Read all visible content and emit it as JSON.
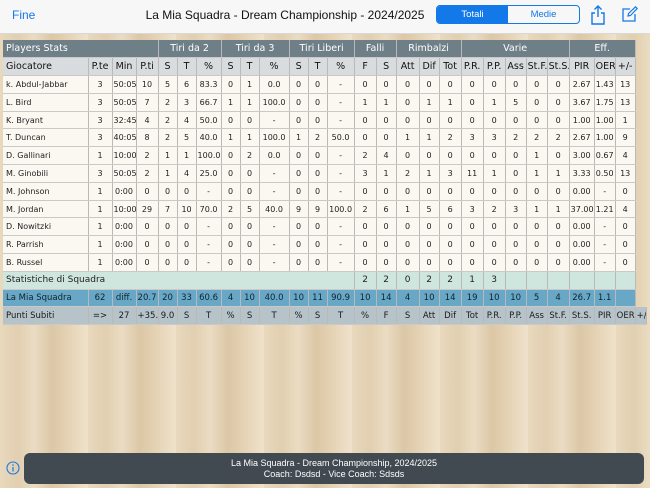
{
  "nav": {
    "back_label": "Fine",
    "title": "La Mia Squadra - Dream Championship - 2024/2025",
    "segments": [
      "Totali",
      "Medie"
    ],
    "active_segment": "Totali",
    "share_icon": "share-icon",
    "edit_icon": "edit-icon"
  },
  "table": {
    "groups": [
      "Players Stats",
      "Tiri da 2",
      "Tiri da 3",
      "Tiri Liberi",
      "Falli",
      "Rimbalzi",
      "Varie",
      "Eff."
    ],
    "columns": [
      "Giocatore",
      "P.te",
      "Min",
      "P.ti",
      "S",
      "T",
      "%",
      "S",
      "T",
      "%",
      "S",
      "T",
      "%",
      "F",
      "S",
      "Att",
      "Dif",
      "Tot",
      "P.R.",
      "P.P.",
      "Ass",
      "St.F.",
      "St.S.",
      "PIR",
      "OER",
      "+/-"
    ],
    "players": [
      [
        "k. Abdul-Jabbar",
        "3",
        "50:05",
        "10",
        "5",
        "6",
        "83.3",
        "0",
        "1",
        "0.0",
        "0",
        "0",
        "-",
        "0",
        "0",
        "0",
        "0",
        "0",
        "0",
        "0",
        "0",
        "0",
        "0",
        "2.67",
        "1.43",
        "13"
      ],
      [
        "L. Bird",
        "3",
        "50:05",
        "7",
        "2",
        "3",
        "66.7",
        "1",
        "1",
        "100.0",
        "0",
        "0",
        "-",
        "1",
        "1",
        "0",
        "1",
        "1",
        "0",
        "1",
        "5",
        "0",
        "0",
        "3.67",
        "1.75",
        "13"
      ],
      [
        "K. Bryant",
        "3",
        "32:45",
        "4",
        "2",
        "4",
        "50.0",
        "0",
        "0",
        "-",
        "0",
        "0",
        "-",
        "0",
        "0",
        "0",
        "0",
        "0",
        "0",
        "0",
        "0",
        "0",
        "0",
        "1.00",
        "1.00",
        "1"
      ],
      [
        "T. Duncan",
        "3",
        "40:05",
        "8",
        "2",
        "5",
        "40.0",
        "1",
        "1",
        "100.0",
        "1",
        "2",
        "50.0",
        "0",
        "0",
        "1",
        "1",
        "2",
        "3",
        "3",
        "2",
        "2",
        "2",
        "2.67",
        "1.00",
        "9"
      ],
      [
        "D. Gallinari",
        "1",
        "10:00",
        "2",
        "1",
        "1",
        "100.0",
        "0",
        "2",
        "0.0",
        "0",
        "0",
        "-",
        "2",
        "4",
        "0",
        "0",
        "0",
        "0",
        "0",
        "0",
        "1",
        "0",
        "3.00",
        "0.67",
        "4"
      ],
      [
        "M. Ginobili",
        "3",
        "50:05",
        "2",
        "1",
        "4",
        "25.0",
        "0",
        "0",
        "-",
        "0",
        "0",
        "-",
        "3",
        "1",
        "2",
        "1",
        "3",
        "11",
        "1",
        "0",
        "1",
        "1",
        "3.33",
        "0.50",
        "13"
      ],
      [
        "M. Johnson",
        "1",
        "0:00",
        "0",
        "0",
        "0",
        "-",
        "0",
        "0",
        "-",
        "0",
        "0",
        "-",
        "0",
        "0",
        "0",
        "0",
        "0",
        "0",
        "0",
        "0",
        "0",
        "0",
        "0.00",
        "-",
        "0"
      ],
      [
        "M. Jordan",
        "1",
        "10:00",
        "29",
        "7",
        "10",
        "70.0",
        "2",
        "5",
        "40.0",
        "9",
        "9",
        "100.0",
        "2",
        "6",
        "1",
        "5",
        "6",
        "3",
        "2",
        "3",
        "1",
        "1",
        "37.00",
        "1.21",
        "4"
      ],
      [
        "D. Nowitzki",
        "1",
        "0:00",
        "0",
        "0",
        "0",
        "-",
        "0",
        "0",
        "-",
        "0",
        "0",
        "-",
        "0",
        "0",
        "0",
        "0",
        "0",
        "0",
        "0",
        "0",
        "0",
        "0",
        "0.00",
        "-",
        "0"
      ],
      [
        "R. Parrish",
        "1",
        "0:00",
        "0",
        "0",
        "0",
        "-",
        "0",
        "0",
        "-",
        "0",
        "0",
        "-",
        "0",
        "0",
        "0",
        "0",
        "0",
        "0",
        "0",
        "0",
        "0",
        "0",
        "0.00",
        "-",
        "0"
      ],
      [
        "B. Russel",
        "1",
        "0:00",
        "0",
        "0",
        "0",
        "-",
        "0",
        "0",
        "-",
        "0",
        "0",
        "-",
        "0",
        "0",
        "0",
        "0",
        "0",
        "0",
        "0",
        "0",
        "0",
        "0",
        "0.00",
        "-",
        "0"
      ]
    ],
    "team_stats": {
      "label": "Statistiche di Squadra",
      "values": [
        "2",
        "2",
        "0",
        "2",
        "2",
        "1",
        "3"
      ]
    },
    "my_team": {
      "cells": [
        "La Mia Squadra",
        "62",
        "diff.",
        "20.7",
        "20",
        "33",
        "60.6",
        "4",
        "10",
        "40.0",
        "10",
        "11",
        "90.9",
        "10",
        "14",
        "4",
        "10",
        "14",
        "19",
        "10",
        "10",
        "5",
        "4",
        "26.7",
        "1.1",
        ""
      ]
    },
    "points_against": {
      "cells": [
        "Punti Subiti",
        "=>",
        "27",
        "+35.0",
        "9.0",
        "S",
        "T",
        "%",
        "S",
        "T",
        "%",
        "S",
        "T",
        "%",
        "F",
        "S",
        "Att",
        "Dif",
        "Tot",
        "P.R.",
        "P.P.",
        "Ass",
        "St.F.",
        "St.S.",
        "PIR",
        "OER",
        "+/-"
      ]
    }
  },
  "footer": {
    "line1": "La Mia Squadra - Dream Championship, 2024/2025",
    "line2": "Coach: Dsdsd - Vice Coach: Sdsds",
    "info_icon": "info-icon"
  }
}
